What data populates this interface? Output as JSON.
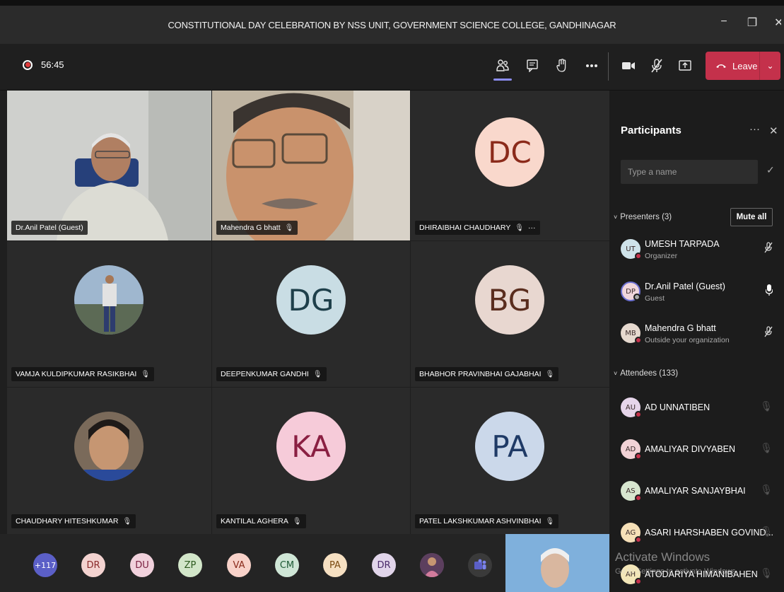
{
  "window": {
    "title": "CONSTITUTIONAL DAY CELEBRATION BY NSS UNIT, GOVERNMENT SCIENCE COLLEGE, GANDHINAGAR",
    "controls": [
      "−",
      "❐",
      "✕"
    ]
  },
  "toolbar": {
    "timer": "56:45",
    "leave_label": "Leave",
    "icons": [
      "participants-icon",
      "chat-icon",
      "raise-hand-icon",
      "more-icon",
      "camera-icon",
      "mic-off-icon",
      "share-screen-icon"
    ]
  },
  "tiles": [
    {
      "name": "Dr.Anil Patel (Guest)",
      "mic": ""
    },
    {
      "name": "Mahendra G bhatt",
      "mic": "🎙"
    },
    {
      "name": "DHIRAIBHAI CHAUDHARY",
      "mic": "🎙",
      "more": "···",
      "initials": "DC",
      "color": "#f9d8cc",
      "text_color": "#8b2a1a"
    },
    {
      "name": "VAMJA KULDIPKUMAR RASIKBHAI",
      "mic": "🎙"
    },
    {
      "name": "DEEPENKUMAR GANDHI",
      "mic": "🎙",
      "initials": "DG",
      "color": "#c9dde4",
      "text_color": "#1e3f4a"
    },
    {
      "name": "BHABHOR PRAVINBHAI GAJABHAI",
      "mic": "🎙",
      "initials": "BG",
      "color": "#e8d7d0",
      "text_color": "#5a2d1e"
    },
    {
      "name": "CHAUDHARY HITESHKUMAR",
      "mic": "🎙"
    },
    {
      "name": "KANTILAL AGHERA",
      "mic": "🎙",
      "initials": "KA",
      "color": "#f6cbd9",
      "text_color": "#8a1f42"
    },
    {
      "name": "PATEL LAKSHKUMAR ASHVINBHAI",
      "mic": "🎙",
      "initials": "PA",
      "color": "#cbd8ea",
      "text_color": "#1f3a66"
    }
  ],
  "strip": [
    {
      "label": "+117",
      "color": "#5b5fc7",
      "text_color": "#ffffff"
    },
    {
      "label": "DR",
      "color": "#f3d3d0",
      "text_color": "#8a2b2b"
    },
    {
      "label": "DU",
      "color": "#f1d1dc",
      "text_color": "#7a1f40"
    },
    {
      "label": "ZP",
      "color": "#d2e6c9",
      "text_color": "#2d5a1f"
    },
    {
      "label": "VA",
      "color": "#f8d2c9",
      "text_color": "#8a2a1a"
    },
    {
      "label": "CM",
      "color": "#cfe6d6",
      "text_color": "#1e5a35"
    },
    {
      "label": "PA",
      "color": "#f6e0c2",
      "text_color": "#7a4a10"
    },
    {
      "label": "DR",
      "color": "#e1d5ea",
      "text_color": "#4a2a6a"
    }
  ],
  "panel": {
    "title": "Participants",
    "more": "···",
    "close": "✕",
    "search_placeholder": "Type a name",
    "presenters_label": "Presenters (3)",
    "mute_all": "Mute all",
    "attendees_label": "Attendees (133)",
    "presenters": [
      {
        "initials": "UT",
        "name": "UMESH TARPADA",
        "role": "Organizer",
        "color": "#cfe3ea"
      },
      {
        "initials": "DP",
        "name": "Dr.Anil Patel (Guest)",
        "role": "Guest",
        "color": "#f0d6dc"
      },
      {
        "initials": "MB",
        "name": "Mahendra G bhatt",
        "role": "Outside your organization",
        "color": "#e6d9cf"
      }
    ],
    "attendees": [
      {
        "initials": "AU",
        "name": "AD UNNATIBEN",
        "color": "#e6d5ea"
      },
      {
        "initials": "AD",
        "name": "AMALIYAR DIVYABEN",
        "color": "#f2d2d6"
      },
      {
        "initials": "AS",
        "name": "AMALIYAR SANJAYBHAI",
        "color": "#d7e6cf"
      },
      {
        "initials": "AG",
        "name": "ASARI HARSHABEN GOVIND...",
        "color": "#f6e0b8"
      },
      {
        "initials": "AH",
        "name": "ATODARIYA HIMANIBAHEN",
        "color": "#f3e6b8"
      }
    ]
  },
  "watermark": {
    "line1": "Activate Windows",
    "line2": "Go to Settings to activate Windows."
  }
}
